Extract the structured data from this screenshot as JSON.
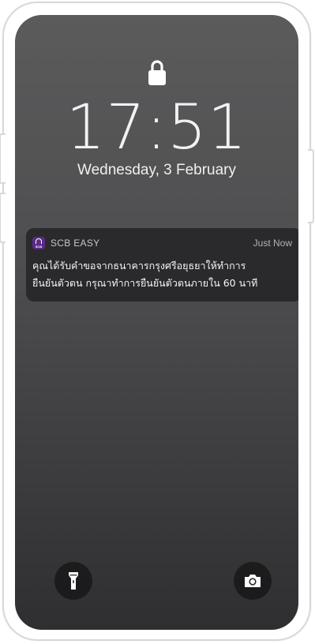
{
  "lock_screen": {
    "time": "17:51",
    "date": "Wednesday, 3 February"
  },
  "notification": {
    "app_icon_text": "SCB",
    "app_name": "SCB EASY",
    "time": "Just Now",
    "body_line_1": "คุณได้รับคำขอจากธนาคารกรุงศรีอยุธยาให้ทำการ",
    "body_line_2": "ยืนยันตัวตน กรุณาทำการยืนยันตัวตนภายใน 60 นาที"
  },
  "quick_actions": {
    "left_icon": "flashlight-icon",
    "right_icon": "camera-icon"
  },
  "colors": {
    "scb_brand": "#5a2a86",
    "notification_bg": "#202022"
  }
}
